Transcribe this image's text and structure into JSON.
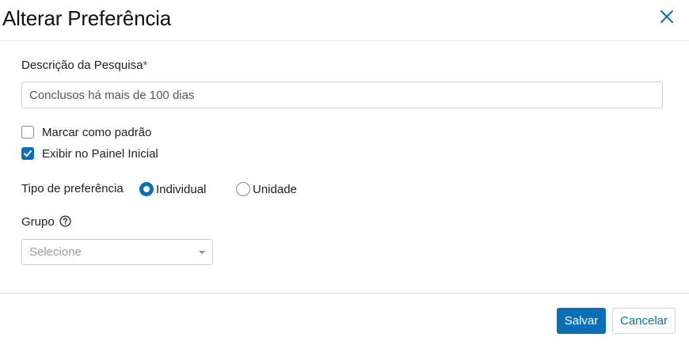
{
  "dialog": {
    "title": "Alterar Preferência",
    "close_icon": "close-icon"
  },
  "form": {
    "description": {
      "label": "Descrição da Pesquisa",
      "required_mark": "*",
      "value": "Conclusos há mais de 100 dias"
    },
    "checkboxes": [
      {
        "label": "Marcar como padrão",
        "checked": false
      },
      {
        "label": "Exibir no Painel Inicial",
        "checked": true
      }
    ],
    "preference_type": {
      "label": "Tipo de preferência",
      "options": [
        {
          "label": "Individual",
          "selected": true
        },
        {
          "label": "Unidade",
          "selected": false
        }
      ]
    },
    "group": {
      "label": "Grupo",
      "help_icon": "help-circle-icon",
      "placeholder": "Selecione"
    }
  },
  "footer": {
    "save_label": "Salvar",
    "cancel_label": "Cancelar"
  },
  "colors": {
    "accent": "#0b6fb5",
    "required": "#d32f2f"
  }
}
